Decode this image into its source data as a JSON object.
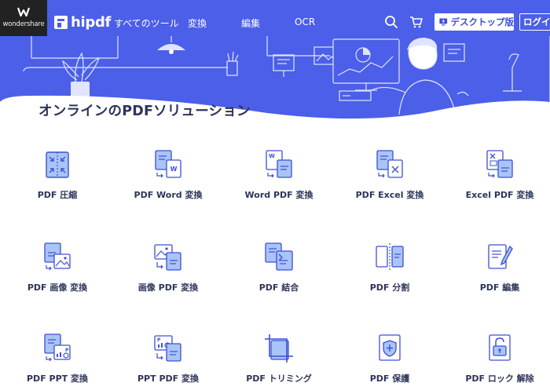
{
  "brand": {
    "company": "wondershare",
    "product": "hipdf"
  },
  "nav": {
    "items": [
      {
        "label": "すべてのツール"
      },
      {
        "label": "変換"
      },
      {
        "label": "編集"
      },
      {
        "label": "OCR"
      }
    ],
    "desktop_button": "デスクトップ版",
    "login_button": "ログイン"
  },
  "icons": {
    "search": "search-icon",
    "cart": "cart-icon",
    "desktop": "monitor-download-icon"
  },
  "colors": {
    "primary": "#4b5fe8",
    "dark_text": "#2d3559",
    "icon_light": "#a9c4f6"
  },
  "section": {
    "title": "オンラインのPDFソリューション"
  },
  "tools": [
    {
      "label": "PDF 圧縮",
      "icon": "compress-icon"
    },
    {
      "label": "PDF Word 変換",
      "icon": "pdf-to-word-icon"
    },
    {
      "label": "Word PDF 変換",
      "icon": "word-to-pdf-icon"
    },
    {
      "label": "PDF Excel 変換",
      "icon": "pdf-to-excel-icon"
    },
    {
      "label": "Excel PDF 変換",
      "icon": "excel-to-pdf-icon"
    },
    {
      "label": "PDF 画像 変換",
      "icon": "pdf-to-image-icon"
    },
    {
      "label": "画像 PDF 変換",
      "icon": "image-to-pdf-icon"
    },
    {
      "label": "PDF 結合",
      "icon": "merge-icon"
    },
    {
      "label": "PDF 分割",
      "icon": "split-icon"
    },
    {
      "label": "PDF 編集",
      "icon": "edit-icon"
    },
    {
      "label": "PDF PPT 変換",
      "icon": "pdf-to-ppt-icon"
    },
    {
      "label": "PPT PDF 変換",
      "icon": "ppt-to-pdf-icon"
    },
    {
      "label": "PDF トリミング",
      "icon": "crop-icon"
    },
    {
      "label": "PDF 保護",
      "icon": "protect-icon"
    },
    {
      "label": "PDF ロック 解除",
      "icon": "unlock-icon"
    }
  ]
}
